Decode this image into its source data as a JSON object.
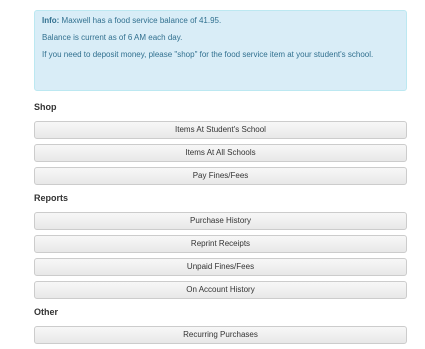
{
  "info": {
    "label": "Info:",
    "balance_text": " Maxwell has a food service balance of 41.95.",
    "current_text": "Balance is current as of 6 AM each day.",
    "deposit_text": "If you need to deposit money, please \"shop\" for the food service item at your student's school."
  },
  "shop": {
    "title": "Shop",
    "items": [
      "Items At Student's School",
      "Items At All Schools",
      "Pay Fines/Fees"
    ]
  },
  "reports": {
    "title": "Reports",
    "items": [
      "Purchase History",
      "Reprint Receipts",
      "Unpaid Fines/Fees",
      "On Account History"
    ]
  },
  "other": {
    "title": "Other",
    "items": [
      "Recurring Purchases"
    ]
  }
}
